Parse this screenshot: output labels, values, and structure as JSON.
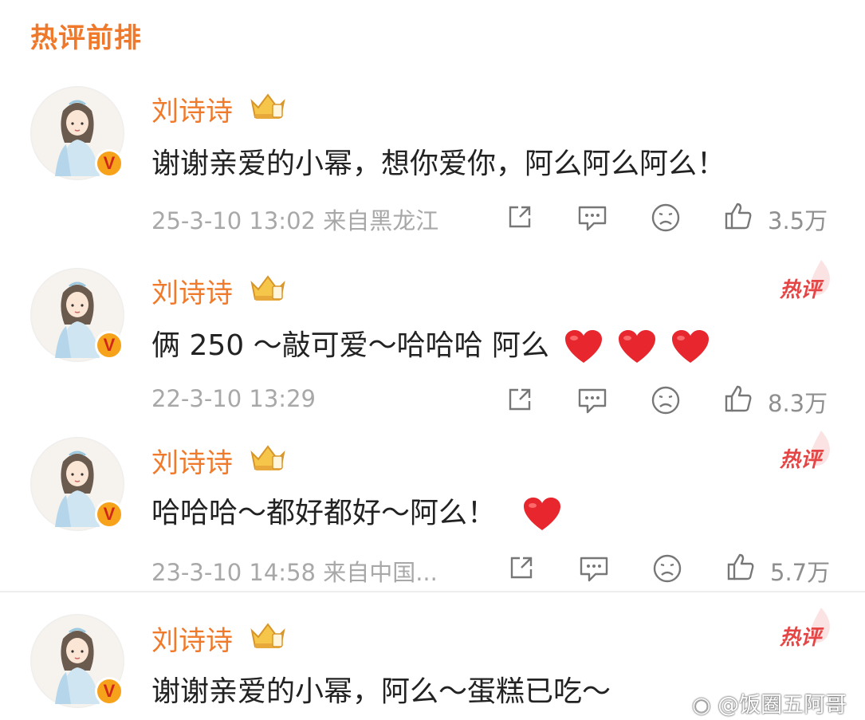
{
  "section_title": "热评前排",
  "comments": [
    {
      "username": "刘诗诗",
      "text": "谢谢亲爱的小幂，想你爱你，阿么阿么阿么！",
      "hearts": 0,
      "meta": "25-3-10 13:02  来自黑龙江",
      "likes": "3.5万",
      "hot_badge": ""
    },
    {
      "username": "刘诗诗",
      "text": "俩 250 ～敲可爱～哈哈哈 阿么",
      "hearts": 3,
      "meta": "22-3-10 13:29",
      "likes": "8.3万",
      "hot_badge": "热评"
    },
    {
      "username": "刘诗诗",
      "text": "哈哈哈～都好都好～阿么！",
      "hearts": 1,
      "meta": "23-3-10 14:58  来自中国...",
      "likes": "5.7万",
      "hot_badge": "热评"
    },
    {
      "username": "刘诗诗",
      "text": "谢谢亲爱的小幂，阿么～蛋糕已吃～",
      "hearts": 0,
      "meta": "",
      "likes": "",
      "hot_badge": "热评"
    }
  ],
  "verified_badge": "V",
  "watermark": "@饭圈五阿哥",
  "icons": [
    "share-icon",
    "comment-icon",
    "sad-face-icon",
    "thumbs-up-icon",
    "heart-emoji-icon",
    "crown-badge-icon",
    "weibo-logo-icon"
  ],
  "colors": {
    "accent": "#f07a2b",
    "hot": "#e64545",
    "meta": "#a8a8a8",
    "text": "#222222",
    "heart": "#e8262e"
  }
}
